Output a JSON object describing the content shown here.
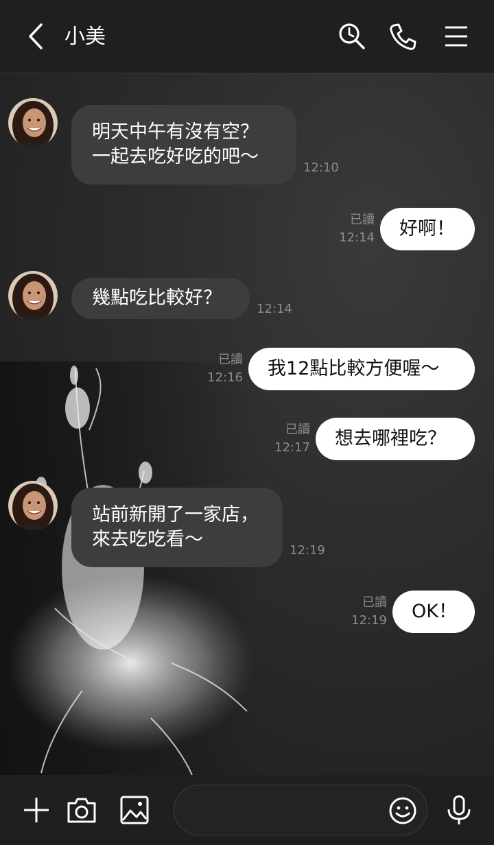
{
  "header": {
    "title": "小美",
    "icons": [
      "back-icon",
      "search-icon",
      "phone-icon",
      "menu-icon"
    ]
  },
  "messages": [
    {
      "side": "in",
      "text": "明天中午有沒有空？\n一起去吃好吃的吧～",
      "time": "12:10"
    },
    {
      "side": "out",
      "text": "好啊！",
      "read": "已讀",
      "time": "12:14"
    },
    {
      "side": "in",
      "text": "幾點吃比較好？",
      "time": "12:14"
    },
    {
      "side": "out",
      "text": "我12點比較方便喔～",
      "read": "已讀",
      "time": "12:16"
    },
    {
      "side": "out",
      "text": "想去哪裡吃？",
      "read": "已讀",
      "time": "12:17"
    },
    {
      "side": "in",
      "text": "站前新開了一家店，\n來去吃吃看～",
      "time": "12:19"
    },
    {
      "side": "out",
      "text": "OK！",
      "read": "已讀",
      "time": "12:19"
    }
  ],
  "footer": {
    "input_placeholder": "",
    "icons": [
      "plus-icon",
      "camera-icon",
      "image-icon",
      "emoji-icon",
      "microphone-icon"
    ]
  },
  "colors": {
    "header_bg": "#1f1f1f",
    "incoming_bubble": "#3d3d3d",
    "outgoing_bubble": "#ffffff",
    "meta_text": "#8c8c8c"
  }
}
